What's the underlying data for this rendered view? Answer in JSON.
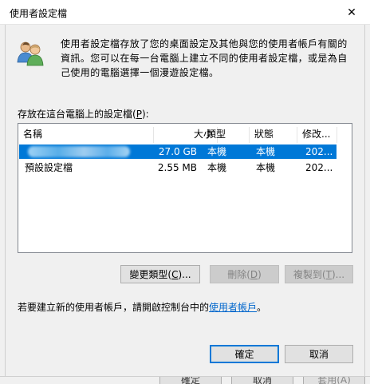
{
  "window": {
    "title": "使用者設定檔",
    "close_glyph": "✕"
  },
  "description": "使用者設定檔存放了您的桌面設定及其他與您的使用者帳戶有關的資訊。您可以在每一台電腦上建立不同的使用者設定檔，或是為自己使用的電腦選擇一個漫遊設定檔。",
  "list": {
    "label_before": "存放在這台電腦上的設定檔(",
    "label_key": "P",
    "label_after": "):",
    "columns": [
      "名稱",
      "大小",
      "類型",
      "狀態",
      "修改..."
    ],
    "rows": [
      {
        "name": "",
        "size": "27.0 GB",
        "type": "本機",
        "status": "本機",
        "modified": "202...",
        "selected": true
      },
      {
        "name": "預設設定檔",
        "size": "2.55 MB",
        "type": "本機",
        "status": "本機",
        "modified": "202...",
        "selected": false
      }
    ]
  },
  "buttons": {
    "change_type": {
      "before": "變更類型(",
      "key": "C",
      "after": ")..."
    },
    "delete": {
      "before": "刪除(",
      "key": "D",
      "after": ")"
    },
    "copy_to": {
      "before": "複製到(",
      "key": "T",
      "after": ")..."
    },
    "ok": "確定",
    "cancel": "取消"
  },
  "info": {
    "text": "若要建立新的使用者帳戶，請開啟控制台中的",
    "link": "使用者帳戶",
    "suffix": "。"
  },
  "background_window": {
    "buttons": [
      "確定",
      "取消",
      "套用(A)"
    ]
  },
  "colors": {
    "selection": "#0078d7",
    "link": "#0066cc",
    "primary_border": "#0078d7"
  }
}
